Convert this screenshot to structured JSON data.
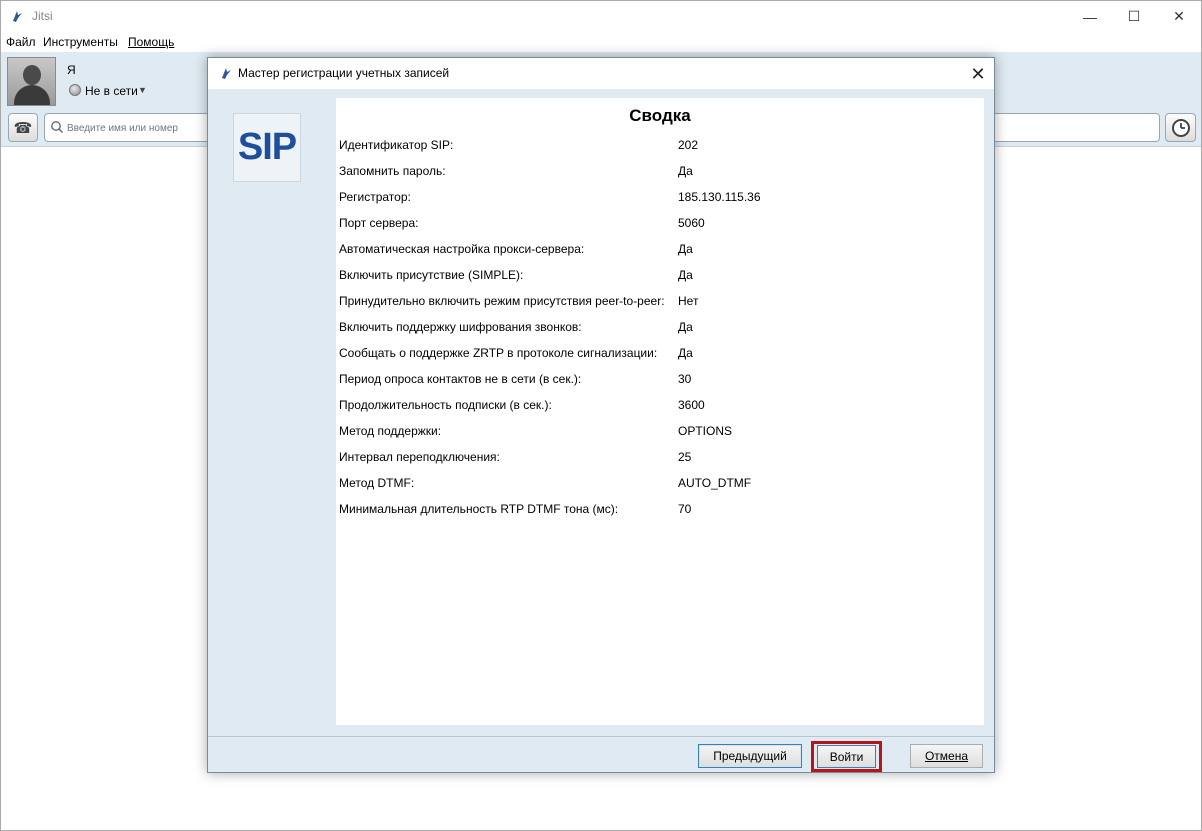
{
  "app": {
    "title": "Jitsi"
  },
  "window_controls": {
    "minimize": "—",
    "maximize": "☐",
    "close": "✕"
  },
  "menu": [
    {
      "label": "Файл"
    },
    {
      "label": "Инструменты"
    },
    {
      "label": "Помощь"
    }
  ],
  "user": {
    "name": "Я",
    "status": "Не в сети"
  },
  "search": {
    "placeholder": "Введите имя или номер"
  },
  "dialog": {
    "title": "Мастер регистрации учетных записей",
    "logo_text": "SIP",
    "summary_title": "Сводка",
    "rows": [
      {
        "label": "Идентификатор SIP:",
        "value": "202"
      },
      {
        "label": "Запомнить пароль:",
        "value": "Да"
      },
      {
        "label": "Регистратор:",
        "value": "185.130.115.36"
      },
      {
        "label": "Порт сервера:",
        "value": "5060"
      },
      {
        "label": "Автоматическая настройка прокси-сервера:",
        "value": "Да"
      },
      {
        "label": "Включить присутствие (SIMPLE):",
        "value": "Да"
      },
      {
        "label": "Принудительно включить режим присутствия peer-to-peer:",
        "value": "Нет"
      },
      {
        "label": "Включить поддержку шифрования звонков:",
        "value": "Да"
      },
      {
        "label": "Сообщать о поддержке ZRTP в протоколе сигнализации:",
        "value": "Да"
      },
      {
        "label": "Период опроса контактов не в сети (в сек.):",
        "value": "30"
      },
      {
        "label": "Продолжительность подписки (в сек.):",
        "value": "3600"
      },
      {
        "label": "Метод поддержки:",
        "value": "OPTIONS"
      },
      {
        "label": "Интервал переподключения:",
        "value": "25"
      },
      {
        "label": "Метод DTMF:",
        "value": "AUTO_DTMF"
      },
      {
        "label": "Минимальная длительность RTP DTMF тона (мс):",
        "value": "70"
      }
    ],
    "buttons": {
      "prev": "Предыдущий",
      "login": "Войти",
      "cancel": "Отмена"
    }
  },
  "colors": {
    "panel_bg": "#dfeaf2",
    "highlight_border": "#b5151b",
    "logo_blue": "#1f4e9c"
  }
}
